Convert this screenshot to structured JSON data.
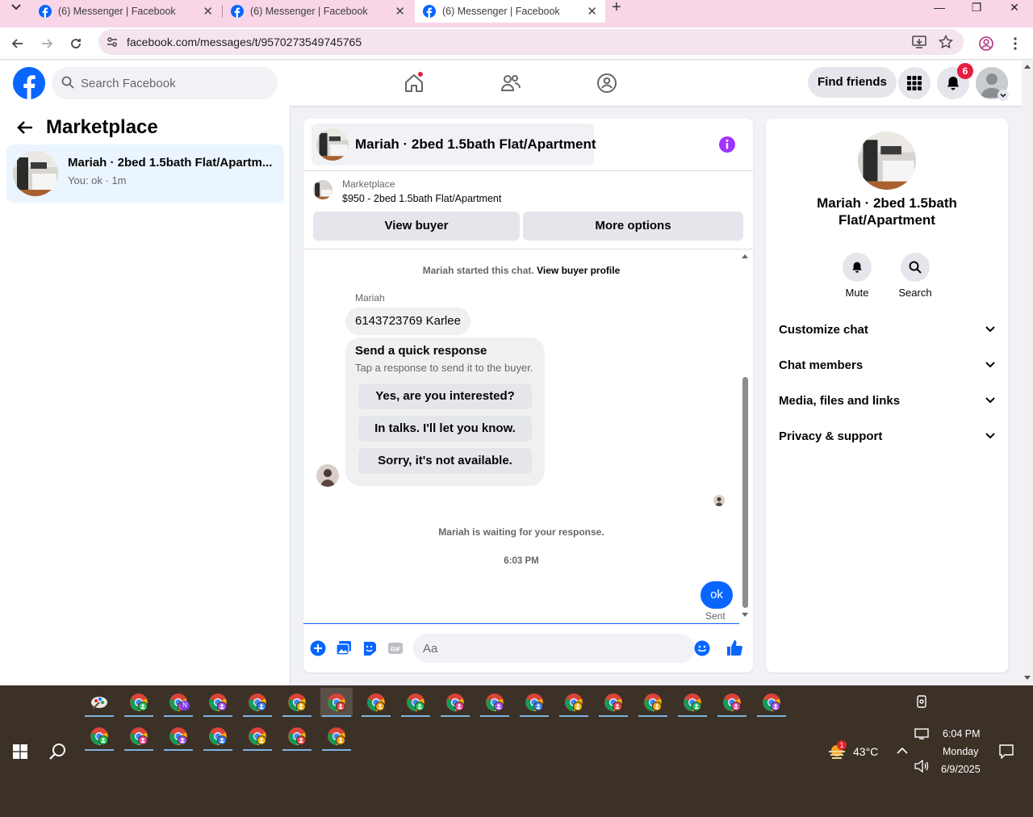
{
  "browser": {
    "tabs": [
      {
        "title": "(6) Messenger | Facebook",
        "active": false
      },
      {
        "title": "(6) Messenger | Facebook",
        "active": false
      },
      {
        "title": "(6) Messenger | Facebook",
        "active": true
      }
    ],
    "url": "facebook.com/messages/t/9570273549745765"
  },
  "fb": {
    "search_placeholder": "Search Facebook",
    "find_friends": "Find friends",
    "notification_count": "6",
    "brand_color": "#0866ff"
  },
  "left": {
    "title": "Marketplace",
    "conversation": {
      "name": "Mariah · 2bed 1.5bath Flat/Apartm...",
      "preview": "You: ok · 1m"
    }
  },
  "chat": {
    "header_name": "Mariah · 2bed 1.5bath Flat/Apartment",
    "marketplace_label": "Marketplace",
    "listing": "$950 - 2bed 1.5bath Flat/Apartment",
    "view_buyer": "View buyer",
    "more_options": "More options",
    "started_text": "Mariah started this chat.",
    "view_buyer_profile": "View buyer profile",
    "sender": "Mariah",
    "message": "6143723769 Karlee",
    "quick_title": "Send a quick response",
    "quick_sub": "Tap a response to send it to the buyer.",
    "quick_options": [
      "Yes, are you interested?",
      "In talks. I'll let you know.",
      "Sorry, it's not available."
    ],
    "waiting": "Mariah is waiting for your response.",
    "time": "6:03 PM",
    "my_message": "ok",
    "status": "Sent",
    "input_placeholder": "Aa"
  },
  "right": {
    "name": "Mariah · 2bed 1.5bath Flat/Apartment",
    "mute": "Mute",
    "search": "Search",
    "sections": [
      "Customize chat",
      "Chat members",
      "Media, files and links",
      "Privacy & support"
    ]
  },
  "taskbar": {
    "temperature": "43°C",
    "weather_badge": "1",
    "time": "6:04 PM",
    "day": "Monday",
    "date": "6/9/2025",
    "pinned_first_row_badge": "N"
  }
}
